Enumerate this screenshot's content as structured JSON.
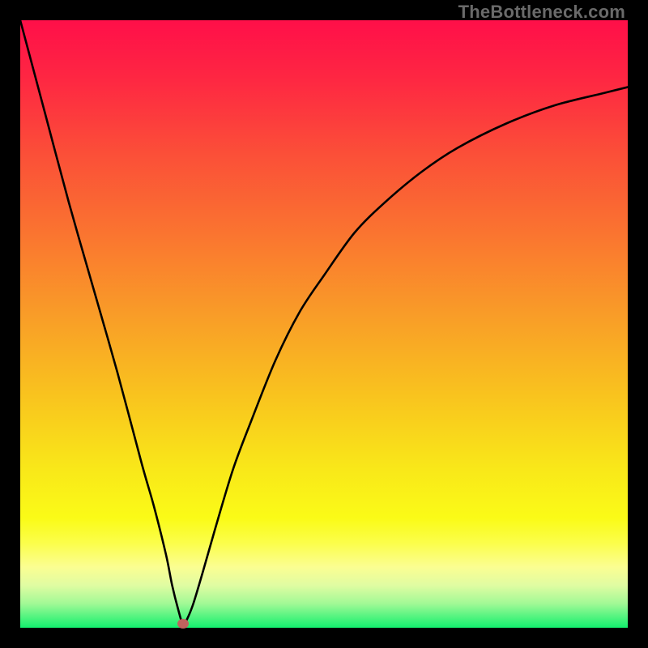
{
  "watermark": "TheBottleneck.com",
  "gradient_stops": [
    {
      "offset": 0.0,
      "color": "#ff0f49"
    },
    {
      "offset": 0.1,
      "color": "#fe2842"
    },
    {
      "offset": 0.22,
      "color": "#fb4f38"
    },
    {
      "offset": 0.35,
      "color": "#fa7430"
    },
    {
      "offset": 0.48,
      "color": "#f99b28"
    },
    {
      "offset": 0.62,
      "color": "#f9c41e"
    },
    {
      "offset": 0.74,
      "color": "#f9e819"
    },
    {
      "offset": 0.82,
      "color": "#fafb17"
    },
    {
      "offset": 0.86,
      "color": "#fbfe4a"
    },
    {
      "offset": 0.9,
      "color": "#fbfe92"
    },
    {
      "offset": 0.93,
      "color": "#e0fca2"
    },
    {
      "offset": 0.96,
      "color": "#a2f996"
    },
    {
      "offset": 0.985,
      "color": "#48f37d"
    },
    {
      "offset": 1.0,
      "color": "#13ef6e"
    }
  ],
  "marker": {
    "x_frac": 0.268,
    "y_frac": 0.993
  },
  "chart_data": {
    "type": "line",
    "title": "",
    "xlabel": "",
    "ylabel": "",
    "xlim": [
      0,
      100
    ],
    "ylim": [
      0,
      100
    ],
    "series": [
      {
        "name": "bottleneck-curve",
        "x": [
          0,
          4,
          8,
          12,
          16,
          20,
          22,
          24,
          25,
          26,
          26.8,
          27.5,
          28.5,
          30,
          32,
          35,
          38,
          42,
          46,
          50,
          55,
          60,
          66,
          72,
          80,
          88,
          96,
          100
        ],
        "y": [
          100,
          85,
          70,
          56,
          42,
          27,
          20,
          12,
          7,
          3,
          0.5,
          1.5,
          4,
          9,
          16,
          26,
          34,
          44,
          52,
          58,
          65,
          70,
          75,
          79,
          83,
          86,
          88,
          89
        ]
      }
    ],
    "marker_point": {
      "x": 26.8,
      "y": 0.5
    },
    "annotations": [
      {
        "text": "TheBottleneck.com",
        "position": "top-right"
      }
    ]
  }
}
